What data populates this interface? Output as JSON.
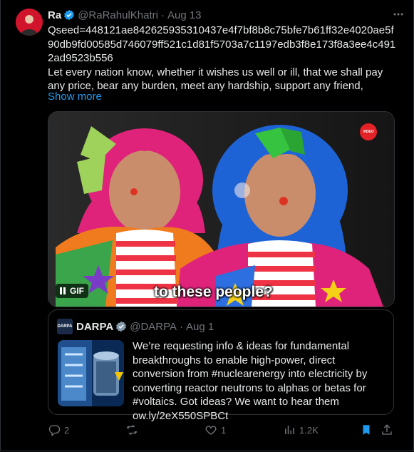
{
  "author": {
    "name": "Ra",
    "handle": "@RaRahulKhatri",
    "dot": "·",
    "date": "Aug 13"
  },
  "tweet": {
    "seed": "Qseed=448121ae842625935310437e4f7bf8b8c75bfe7b61ff32e4020ae5f90db9fd00585d746079ff521c1d81f5703a7c1197edb3f8e173f8a3ee4c4912ad9523b556",
    "body": "Let every nation know, whether it wishes us well or ill, that we shall pay any price, bear any burden, meet any hardship, support any friend,",
    "show_more": "Show more"
  },
  "media": {
    "gif_label": "GIF",
    "caption": "to these people?",
    "channel_badge": "VIDEO"
  },
  "quote": {
    "avatar_text": "DARPA",
    "name": "DARPA",
    "handle": "@DARPA",
    "dot": "·",
    "date": "Aug 1",
    "text": "We’re requesting info & ideas for fundamental breakthroughs to enable high-power, direct conversion from #nuclearenergy into electricity by converting reactor neutrons to alphas or betas for #voltaics. Got ideas? We want to hear them ow.ly/2eX550SPBCt"
  },
  "actions": {
    "replies": "2",
    "reposts": "",
    "likes": "1",
    "views": "1.2K"
  },
  "colors": {
    "accent": "#1d9bf0",
    "muted": "#71767b",
    "border": "#2f3336",
    "background": "#000000"
  },
  "icons": [
    "verified-badge-icon",
    "more-icon",
    "pause-icon",
    "reply-icon",
    "repost-icon",
    "like-icon",
    "views-icon",
    "bookmark-icon",
    "share-icon"
  ]
}
